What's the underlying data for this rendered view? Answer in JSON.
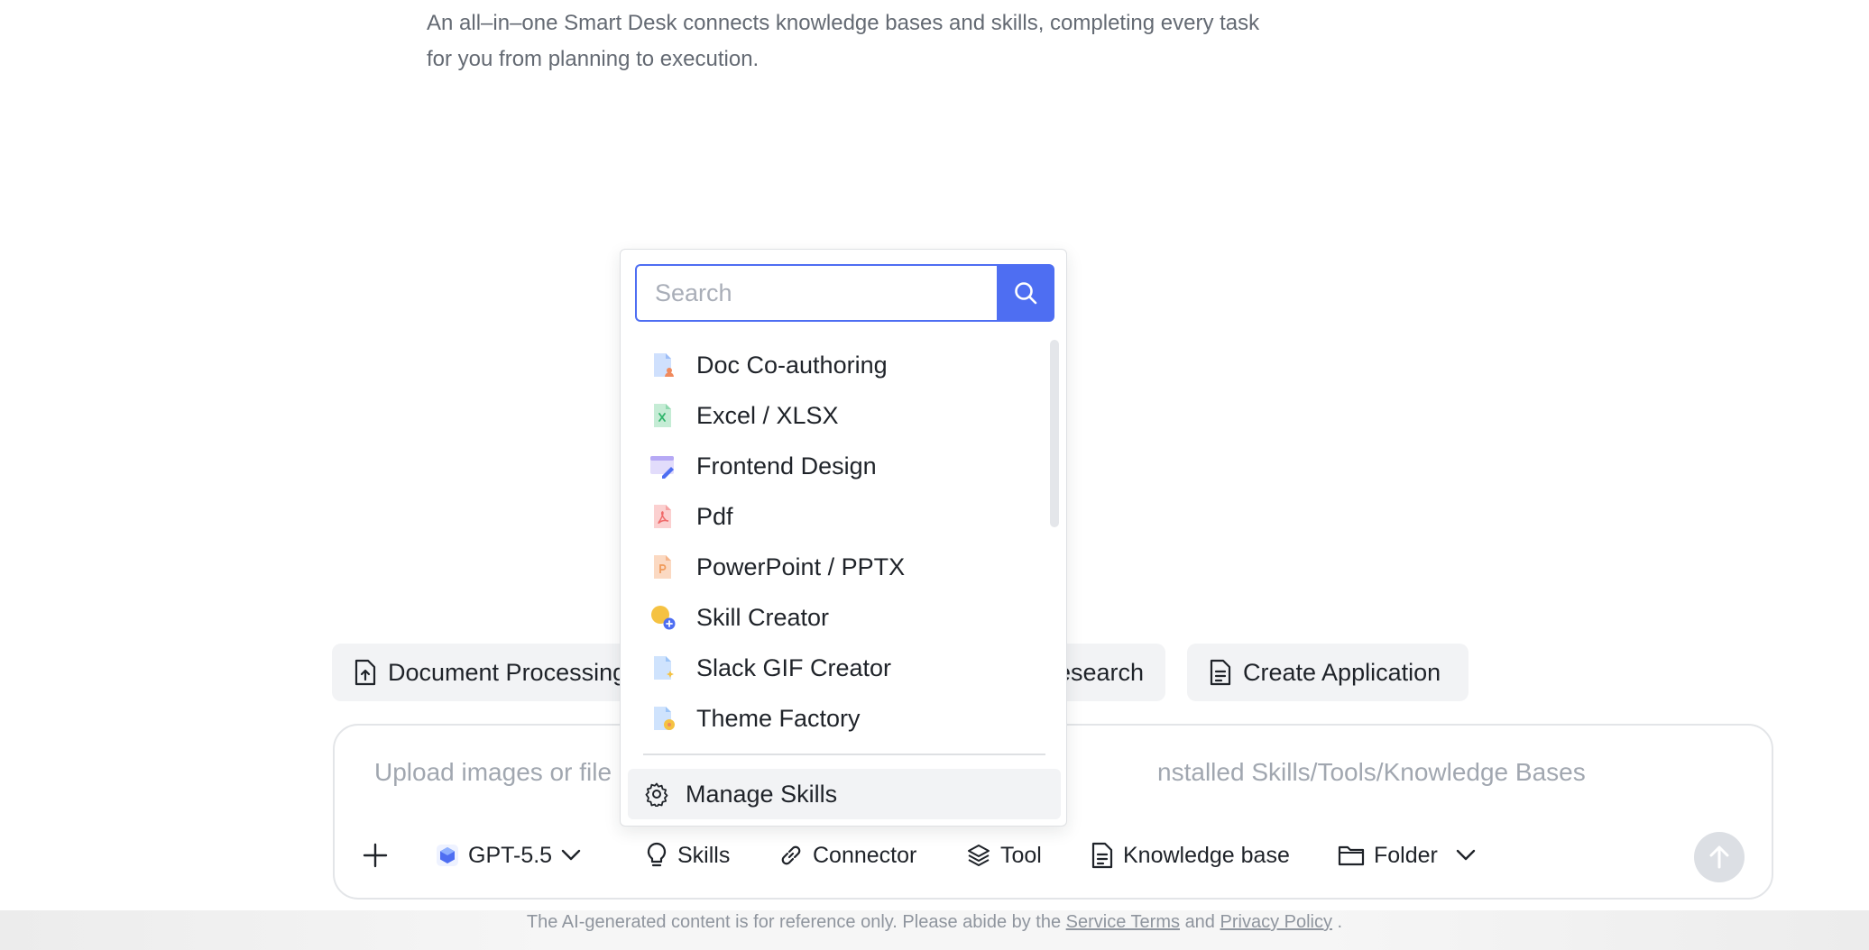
{
  "intro": {
    "line1": "An all–in–one Smart Desk connects knowledge bases and skills, completing every task",
    "line2": "for you from planning to execution."
  },
  "chips": {
    "document_processing": "Document Processing",
    "research": "esearch",
    "create_application": "Create Application"
  },
  "composer": {
    "placeholder_left": "Upload images or file",
    "placeholder_right": "nstalled Skills/Tools/Knowledge Bases",
    "model": "GPT-5.5",
    "skills": "Skills",
    "connector": "Connector",
    "tool": "Tool",
    "knowledge_base": "Knowledge base",
    "folder": "Folder"
  },
  "popover": {
    "search_placeholder": "Search",
    "skills": [
      {
        "label": "Doc Co-authoring",
        "icon": "doc-coauthoring-icon",
        "color": "#4e8cf7"
      },
      {
        "label": "Excel / XLSX",
        "icon": "excel-icon",
        "color": "#2fb56b"
      },
      {
        "label": "Frontend Design",
        "icon": "frontend-design-icon",
        "color": "#7b6cf2"
      },
      {
        "label": "Pdf",
        "icon": "pdf-icon",
        "color": "#f06a6a"
      },
      {
        "label": "PowerPoint / PPTX",
        "icon": "powerpoint-icon",
        "color": "#f09a5a"
      },
      {
        "label": "Skill Creator",
        "icon": "skill-creator-icon",
        "color": "#f5c242"
      },
      {
        "label": "Slack GIF Creator",
        "icon": "slack-gif-icon",
        "color": "#5aa0f5"
      },
      {
        "label": "Theme Factory",
        "icon": "theme-factory-icon",
        "color": "#5aa0f5"
      }
    ],
    "manage_label": "Manage Skills"
  },
  "footer": {
    "prefix": "The AI-generated content is for reference only. Please abide by the",
    "service_terms": "Service Terms",
    "and": "and",
    "privacy_policy": "Privacy Policy",
    "suffix": "."
  },
  "colors": {
    "accent": "#4e6ef2",
    "chip_bg": "#f2f3f5",
    "muted_text": "#646a73"
  }
}
